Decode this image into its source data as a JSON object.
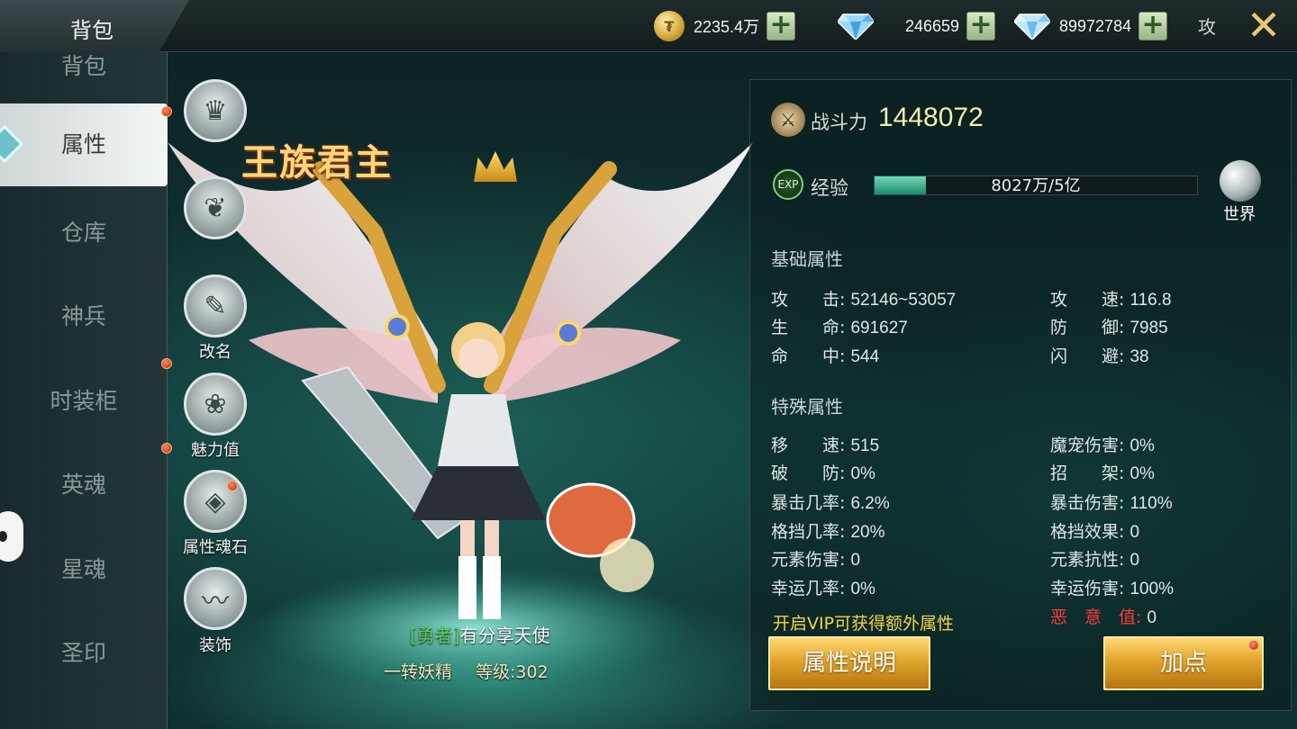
{
  "header": {
    "title": "背包",
    "coins": "2235.4万",
    "gems_blue": "246659",
    "gems_diamond": "89972784",
    "attack_label": "攻"
  },
  "nav": {
    "items": [
      "背包",
      "属性",
      "仓库",
      "神兵",
      "时装柜",
      "英魂",
      "星魂",
      "圣印"
    ],
    "active": "属性"
  },
  "side_icons": [
    {
      "label": "",
      "icon": "crown-shield-icon"
    },
    {
      "label": "",
      "icon": "wings-icon"
    },
    {
      "label": "改名",
      "icon": "edit-icon"
    },
    {
      "label": "魅力值",
      "icon": "charm-icon"
    },
    {
      "label": "属性魂石",
      "icon": "soul-stone-icon"
    },
    {
      "label": "装饰",
      "icon": "mustache-icon"
    }
  ],
  "character": {
    "emblem": "王族君主",
    "tag": "[勇者]",
    "name": "有分享天使",
    "class": "一转妖精",
    "level_label": "等级:",
    "level": "302"
  },
  "stats_panel": {
    "power_label": "战斗力",
    "power": "1448072",
    "exp_label": "经验",
    "exp_text": "8027万/5亿",
    "exp_fraction": 0.16,
    "world_label": "世界",
    "basic_title": "基础属性",
    "basic": [
      {
        "k": "攻　　击:",
        "v": "52146~53057"
      },
      {
        "k": "攻　　速:",
        "v": "116.8"
      },
      {
        "k": "生　　命:",
        "v": "691627"
      },
      {
        "k": "防　　御:",
        "v": "7985"
      },
      {
        "k": "命　　中:",
        "v": "544"
      },
      {
        "k": "闪　　避:",
        "v": "38"
      }
    ],
    "special_title": "特殊属性",
    "special": [
      {
        "k": "移　　速:",
        "v": "515"
      },
      {
        "k": "魔宠伤害:",
        "v": "0%"
      },
      {
        "k": "破　　防:",
        "v": "0%"
      },
      {
        "k": "招　　架:",
        "v": "0%"
      },
      {
        "k": "暴击几率:",
        "v": "6.2%"
      },
      {
        "k": "暴击伤害:",
        "v": "110%"
      },
      {
        "k": "格挡几率:",
        "v": "20%"
      },
      {
        "k": "格挡效果:",
        "v": "0"
      },
      {
        "k": "元素伤害:",
        "v": "0"
      },
      {
        "k": "元素抗性:",
        "v": "0"
      },
      {
        "k": "幸运几率:",
        "v": "0%"
      },
      {
        "k": "幸运伤害:",
        "v": "100%"
      },
      {
        "k": "恶　意　值:",
        "v": "0"
      }
    ],
    "vip_text": "开启VIP可获得额外属性",
    "btn_explain": "属性说明",
    "btn_addpoints": "加点"
  }
}
